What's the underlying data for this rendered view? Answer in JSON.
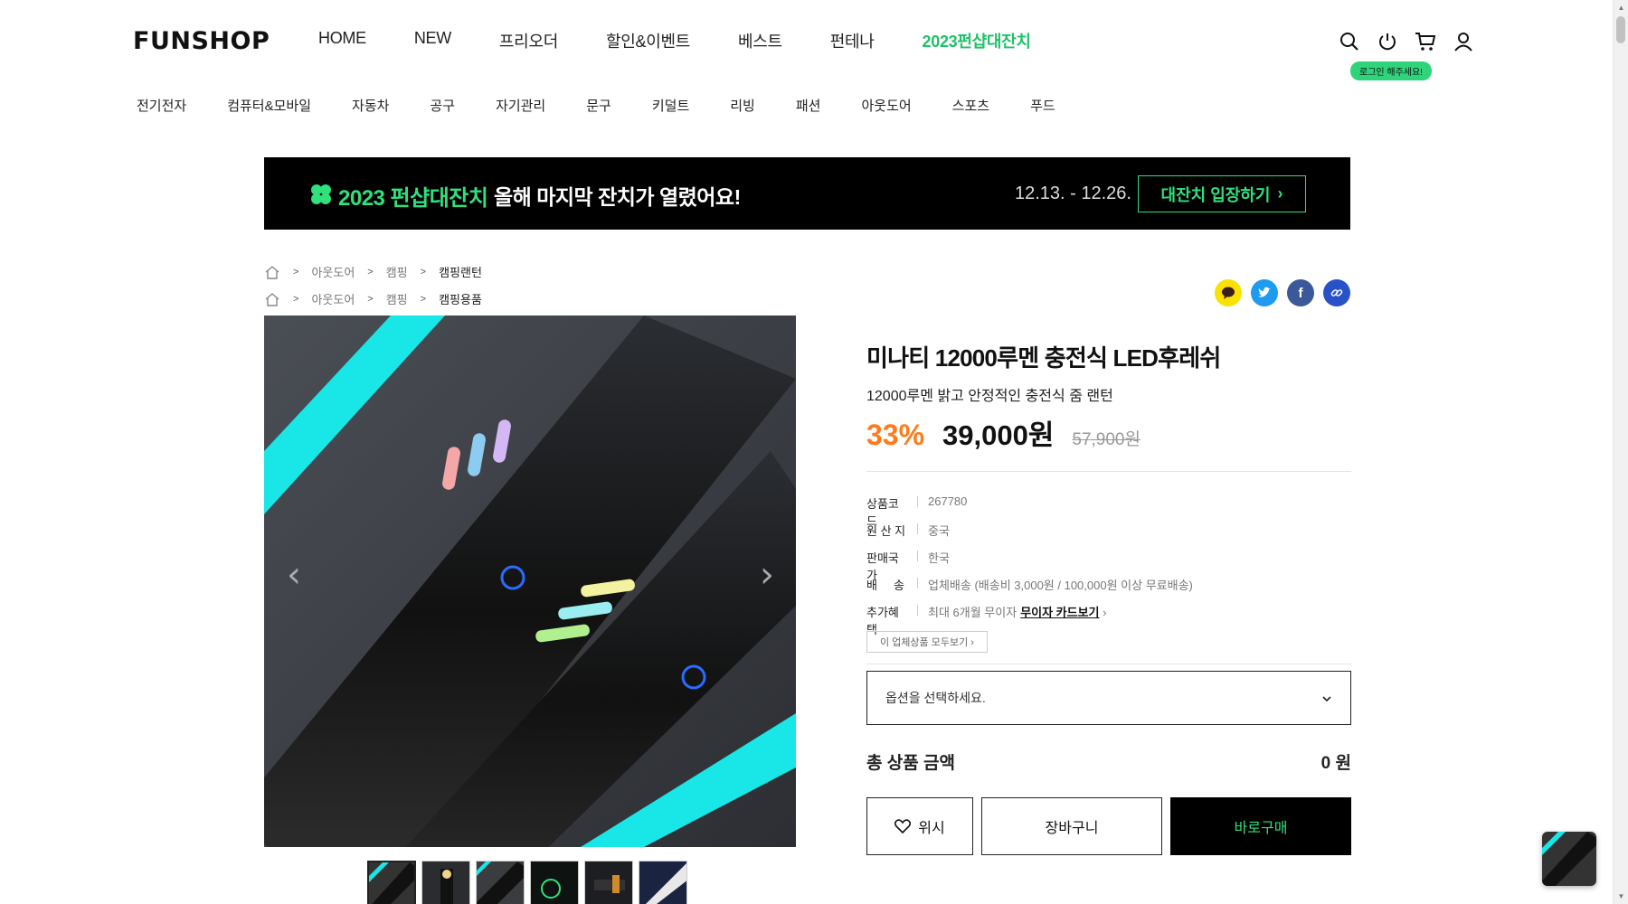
{
  "header": {
    "logo": "FUNSHOP",
    "nav": [
      "HOME",
      "NEW",
      "프리오더",
      "할인&이벤트",
      "베스트",
      "펀테나",
      "2023펀샵대잔치"
    ],
    "login_tip": "로그인 해주세요!"
  },
  "categories": [
    "전기전자",
    "컴퓨터&모바일",
    "자동차",
    "공구",
    "자기관리",
    "문구",
    "키덜트",
    "리빙",
    "패션",
    "아웃도어",
    "스포츠",
    "푸드"
  ],
  "banner": {
    "title": "2023 펀샵대잔치",
    "subtitle": "올해 마지막 잔치가 열렸어요!",
    "date": "12.13. - 12.26.",
    "button": "대잔치 입장하기"
  },
  "breadcrumbs": [
    [
      "아웃도어",
      "캠핑",
      "캠핑랜턴"
    ],
    [
      "아웃도어",
      "캠핑",
      "캠핑용품"
    ]
  ],
  "product": {
    "name": "미나티 12000루멘 충전식 LED후레쉬",
    "desc": "12000루멘 밝고 안정적인 충전식 줌 랜턴",
    "discount": "33%",
    "price": "39,000원",
    "original": "57,900원",
    "specs": [
      {
        "k": "상품코드",
        "v": "267780"
      },
      {
        "k": "원 산 지",
        "v": "중국"
      },
      {
        "k": "판매국가",
        "v": "한국"
      },
      {
        "k": "배     송",
        "v": "업체배송 (배송비 3,000원 / 100,000원 이상 무료배송)"
      },
      {
        "k": "추가혜택",
        "v": "최대 6개월 무이자",
        "link": "무이자 카드보기"
      }
    ],
    "seller_btn": "이 업체상품 모두보기",
    "select_placeholder": "옵션을 선택하세요.",
    "total_label": "총 상품 금액",
    "total_value": "0 원",
    "wish": "위시",
    "cart": "장바구니",
    "buy": "바로구매"
  },
  "colors": {
    "accent_green": "#2fe07d",
    "discount_orange": "#ff7a1a"
  }
}
